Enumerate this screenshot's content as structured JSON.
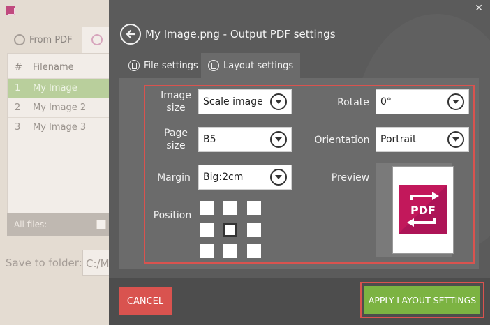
{
  "background_app": {
    "tabs": [
      {
        "label": "From PDF"
      }
    ],
    "table": {
      "headers": [
        "#",
        "Filename"
      ],
      "rows": [
        {
          "num": "1",
          "name": "My Image"
        },
        {
          "num": "2",
          "name": "My Image 2"
        },
        {
          "num": "3",
          "name": "My Image 3"
        }
      ]
    },
    "all_files_label": "All files:",
    "save_folder_label": "Save to folder:",
    "save_folder_value": "C:/M"
  },
  "dialog": {
    "title": "My Image.png - Output PDF settings",
    "tabs": [
      {
        "label": "File settings",
        "active": false
      },
      {
        "label": "Layout settings",
        "active": true
      }
    ],
    "fields": {
      "image_size": {
        "label_l1": "Image",
        "label_l2": "size",
        "value": "Scale image"
      },
      "page_size": {
        "label_l1": "Page",
        "label_l2": "size",
        "value": "B5"
      },
      "margin": {
        "label": "Margin",
        "value": "Big:2cm"
      },
      "rotate": {
        "label": "Rotate",
        "value": "0°"
      },
      "orientation": {
        "label": "Orientation",
        "value": "Portrait"
      },
      "position": {
        "label": "Position",
        "selected_index": 4
      },
      "preview": {
        "label": "Preview",
        "logo_text": "PDF"
      }
    },
    "buttons": {
      "cancel": "CANCEL",
      "apply": "APPLY LAYOUT SETTINGS"
    },
    "colors": {
      "accent_red": "#d9534f",
      "apply_green": "#7cb342",
      "logo_magenta": "#c2185b"
    }
  }
}
